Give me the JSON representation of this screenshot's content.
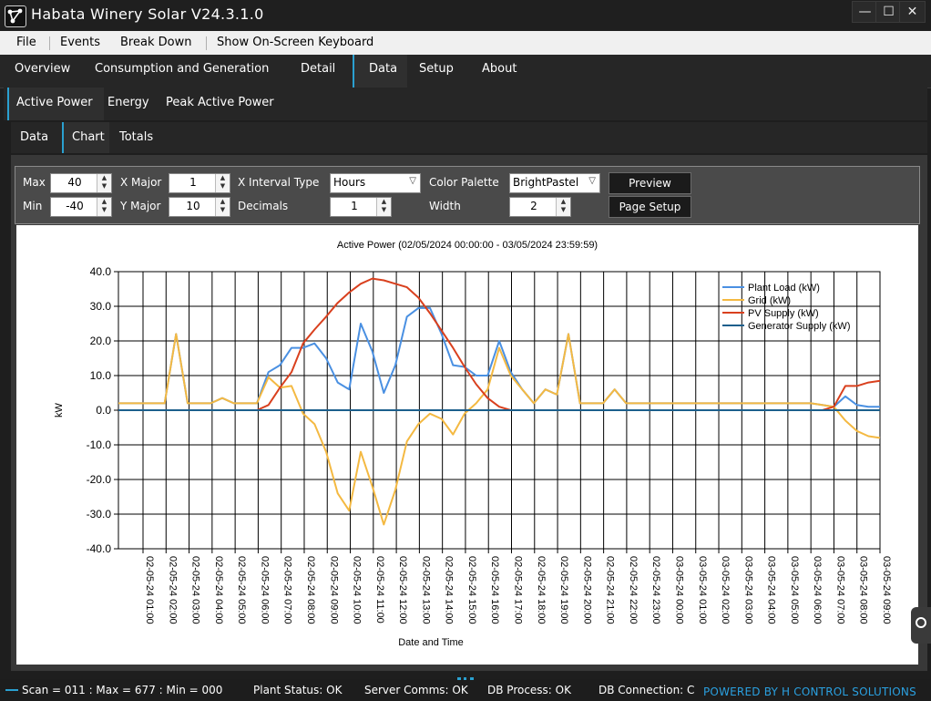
{
  "app": {
    "title": "Habata Winery Solar V24.3.1.0"
  },
  "window_controls": {
    "minimize": "—",
    "maximize": "☐",
    "close": "✕"
  },
  "menu": [
    "File",
    "Events",
    "Break Down",
    "Show On-Screen Keyboard"
  ],
  "main_tabs": [
    "Overview",
    "Consumption and Generation",
    "Detail",
    "Data",
    "Setup",
    "About"
  ],
  "main_tab_active": "Data",
  "sub_tabs": [
    "Active Power",
    "Energy",
    "Peak Active Power"
  ],
  "sub_tab_active": "Active Power",
  "view_tabs": [
    "Data",
    "Chart",
    "Totals"
  ],
  "view_tab_active": "Chart",
  "controls": {
    "max_label": "Max",
    "max_value": "40",
    "min_label": "Min",
    "min_value": "-40",
    "xmajor_label": "X Major",
    "xmajor_value": "1",
    "ymajor_label": "Y Major",
    "ymajor_value": "10",
    "xinterval_label": "X Interval Type",
    "xinterval_value": "Hours",
    "decimals_label": "Decimals",
    "decimals_value": "1",
    "palette_label": "Color Palette",
    "palette_value": "BrightPastel",
    "width_label": "Width",
    "width_value": "2",
    "preview_button": "Preview",
    "pagesetup_button": "Page Setup"
  },
  "status": {
    "scan": "Scan = 011 : Max = 677 : Min = 000",
    "plant": "Plant Status: OK",
    "server": "Server Comms: OK",
    "db_process": "DB Process:  OK",
    "db_conn": "DB Connection: C",
    "powered": "POWERED BY H CONTROL SOLUTIONS"
  },
  "chart_data": {
    "type": "line",
    "title": "Active Power   (02/05/2024 00:00:00 - 03/05/2024 23:59:59)",
    "xlabel": "Date and Time",
    "ylabel": "kW",
    "ylim": [
      -40,
      40
    ],
    "ytick_step": 10,
    "grid": true,
    "legend_position": "top-right",
    "x_tick_labels": [
      "02-05-24 01:00",
      "02-05-24 02:00",
      "02-05-24 03:00",
      "02-05-24 04:00",
      "02-05-24 05:00",
      "02-05-24 06:00",
      "02-05-24 07:00",
      "02-05-24 08:00",
      "02-05-24 09:00",
      "02-05-24 10:00",
      "02-05-24 11:00",
      "02-05-24 12:00",
      "02-05-24 13:00",
      "02-05-24 14:00",
      "02-05-24 15:00",
      "02-05-24 16:00",
      "02-05-24 17:00",
      "02-05-24 18:00",
      "02-05-24 19:00",
      "02-05-24 20:00",
      "02-05-24 21:00",
      "02-05-24 22:00",
      "02-05-24 23:00",
      "03-05-24 00:00",
      "03-05-24 01:00",
      "03-05-24 02:00",
      "03-05-24 03:00",
      "03-05-24 04:00",
      "03-05-24 05:00",
      "03-05-24 06:00",
      "03-05-24 07:00",
      "03-05-24 08:00",
      "03-05-24 09:00"
    ],
    "x_hours": [
      0,
      0.5,
      1,
      1.5,
      2,
      2.5,
      3,
      3.5,
      4,
      4.5,
      5,
      5.5,
      6,
      6.5,
      7,
      7.5,
      8,
      8.5,
      9,
      9.5,
      10,
      10.5,
      11,
      11.5,
      12,
      12.5,
      13,
      13.5,
      14,
      14.5,
      15,
      15.5,
      16,
      16.5,
      17,
      17.5,
      18,
      18.5,
      19,
      19.5,
      20,
      20.5,
      21,
      21.5,
      22,
      22.5,
      23,
      23.5,
      24,
      24.5,
      25,
      25.5,
      26,
      26.5,
      27,
      27.5,
      28,
      28.5,
      29,
      29.5,
      30,
      30.5,
      31,
      31.5,
      32,
      32.5,
      33
    ],
    "series": [
      {
        "name": "Plant Load (kW)",
        "color": "#4a90e2",
        "values": [
          2,
          2,
          2,
          2,
          2,
          22,
          2,
          2,
          2,
          3.5,
          2,
          2,
          2,
          11,
          13,
          18,
          18,
          19.3,
          15,
          8,
          6,
          25,
          17,
          5,
          13,
          27,
          29.5,
          29.5,
          22,
          13,
          12.5,
          10,
          10,
          20,
          11,
          6,
          2,
          6,
          4.5,
          22,
          2,
          2,
          2,
          6,
          2,
          2,
          2,
          2,
          2,
          2,
          2,
          2,
          2,
          2,
          2,
          2,
          2,
          2,
          2,
          2,
          2,
          1.5,
          1,
          4,
          1.5,
          1,
          1
        ]
      },
      {
        "name": "Grid (kW)",
        "color": "#f4b942",
        "values": [
          2,
          2,
          2,
          2,
          2,
          22,
          2,
          2,
          2,
          3.5,
          2,
          2,
          2,
          9.5,
          6.5,
          7,
          -1,
          -4,
          -12,
          -24,
          -29,
          -12,
          -22,
          -33,
          -23,
          -9,
          -4,
          -1,
          -2.5,
          -7,
          -1,
          2,
          6,
          18,
          10,
          6,
          2,
          6,
          4.5,
          22,
          2,
          2,
          2,
          6,
          2,
          2,
          2,
          2,
          2,
          2,
          2,
          2,
          2,
          2,
          2,
          2,
          2,
          2,
          2,
          2,
          2,
          1.5,
          1,
          -3,
          -6,
          -7.5,
          -8
        ]
      },
      {
        "name": "PV Supply (kW)",
        "color": "#d9401e",
        "values": [
          null,
          null,
          null,
          null,
          null,
          null,
          null,
          null,
          null,
          null,
          null,
          null,
          0,
          1.5,
          6.5,
          11,
          19.3,
          23.3,
          27,
          31,
          34,
          36.5,
          38,
          37.5,
          36.5,
          35.5,
          32.5,
          28,
          23,
          18,
          12.5,
          7.5,
          3.5,
          1,
          0,
          null,
          null,
          null,
          null,
          null,
          null,
          null,
          null,
          null,
          null,
          null,
          null,
          null,
          null,
          null,
          null,
          null,
          null,
          null,
          null,
          null,
          null,
          null,
          null,
          null,
          null,
          0,
          1,
          7,
          7,
          8,
          8.5
        ]
      },
      {
        "name": "Generator Supply (kW)",
        "color": "#1c5f8c",
        "values": [
          0,
          0,
          0,
          0,
          0,
          0,
          0,
          0,
          0,
          0,
          0,
          0,
          0,
          0,
          0,
          0,
          0,
          0,
          0,
          0,
          0,
          0,
          0,
          0,
          0,
          0,
          0,
          0,
          0,
          0,
          0,
          0,
          0,
          0,
          0,
          0,
          0,
          0,
          0,
          0,
          0,
          0,
          0,
          0,
          0,
          0,
          0,
          0,
          0,
          0,
          0,
          0,
          0,
          0,
          0,
          0,
          0,
          0,
          0,
          0,
          0,
          0,
          0,
          0,
          0,
          0,
          0
        ]
      }
    ]
  }
}
